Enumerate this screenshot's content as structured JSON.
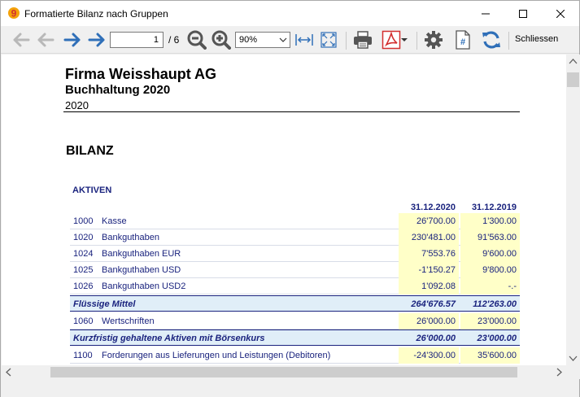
{
  "window": {
    "title": "Formatierte Bilanz nach Gruppen"
  },
  "toolbar": {
    "page_value": "1",
    "page_total": "/ 6",
    "zoom_value": "90%",
    "close_label": "Schliessen"
  },
  "report": {
    "company": "Firma Weisshaupt AG",
    "subtitle": "Buchhaltung 2020",
    "year": "2020",
    "section_title": "BILANZ",
    "group_title": "AKTIVEN",
    "col1_header": "31.12.2020",
    "col2_header": "31.12.2019",
    "rows": [
      {
        "type": "normal",
        "num": "1000",
        "text": "Kasse",
        "v1": "26'700.00",
        "v2": "1'300.00"
      },
      {
        "type": "normal",
        "num": "1020",
        "text": "Bankguthaben",
        "v1": "230'481.00",
        "v2": "91'563.00"
      },
      {
        "type": "normal",
        "num": "1024",
        "text": "Bankguthaben EUR",
        "v1": "7'553.76",
        "v2": "9'600.00"
      },
      {
        "type": "normal",
        "num": "1025",
        "text": "Bankguthaben USD",
        "v1": "-1'150.27",
        "v2": "9'800.00"
      },
      {
        "type": "normal",
        "num": "1026",
        "text": "Bankguthaben USD2",
        "v1": "1'092.08",
        "v2": "-.-"
      },
      {
        "type": "sum",
        "num": "",
        "text": "Flüssige Mittel",
        "v1": "264'676.57",
        "v2": "112'263.00"
      },
      {
        "type": "normal",
        "num": "1060",
        "text": "Wertschriften",
        "v1": "26'000.00",
        "v2": "23'000.00"
      },
      {
        "type": "sum",
        "num": "",
        "text": "Kurzfristig gehaltene Aktiven mit Börsenkurs",
        "v1": "26'000.00",
        "v2": "23'000.00"
      },
      {
        "type": "normal",
        "num": "1100",
        "text": "Forderungen aus Lieferungen und Leistungen (Debitoren)",
        "v1": "-24'300.00",
        "v2": "35'600.00"
      }
    ]
  },
  "colors": {
    "accent_blue": "#1a237e",
    "cell_yellow": "#ffffc8",
    "sum_row": "#e0eef8"
  }
}
